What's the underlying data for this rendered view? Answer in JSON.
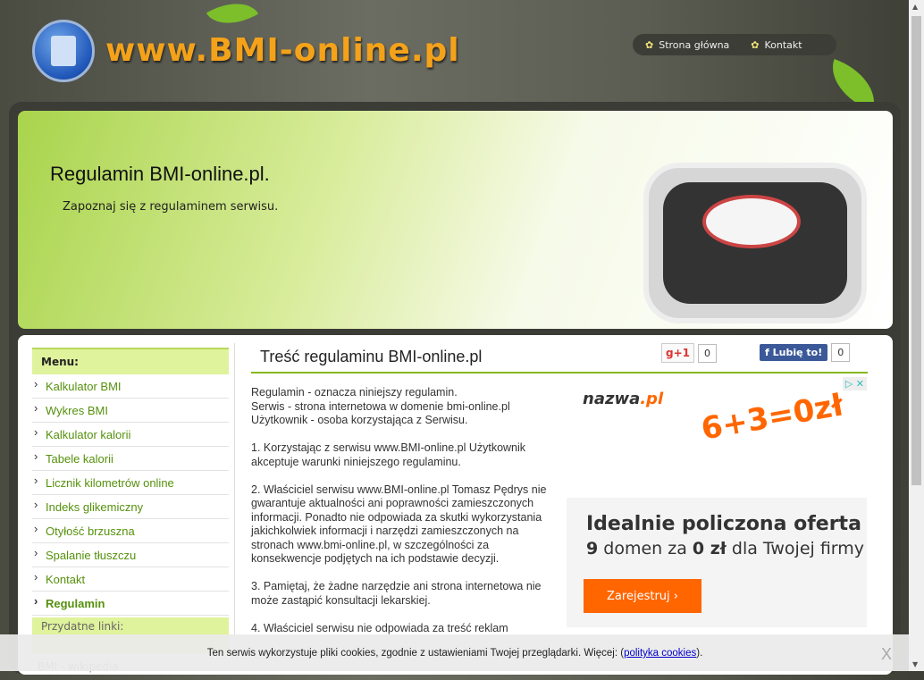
{
  "header": {
    "site_name": "www.BMI-online.pl",
    "nav": [
      "Strona główna",
      "Kontakt"
    ]
  },
  "banner": {
    "title": "Regulamin BMI-online.pl.",
    "subtitle": "Zapoznaj się z regulaminem serwisu."
  },
  "sidebar": {
    "menu_title": "Menu:",
    "items": [
      "Kalkulator BMI",
      "Wykres BMI",
      "Kalkulator kalorii",
      "Tabele kalorii",
      "Licznik kilometrów online",
      "Indeks glikemiczny",
      "Otyłość brzuszna",
      "Spalanie tłuszczu",
      "Kontakt",
      "Regulamin"
    ],
    "links_title": "Przydatne linki:",
    "links": [
      "BMI - wikipedia"
    ]
  },
  "content": {
    "title": "Treść regulaminu BMI-online.pl",
    "gplus_label": "g+1",
    "gplus_count": "0",
    "fb_label": "Lubię to!",
    "fb_count": "0",
    "paragraphs": [
      "Regulamin - oznacza niniejszy regulamin.\nSerwis - strona internetowa w domenie bmi-online.pl\nUżytkownik - osoba korzystająca z Serwisu.",
      "1. Korzystając z serwisu www.BMI-online.pl Użytkownik akceptuje warunki niniejszego regulaminu.",
      "2. Właściciel serwisu www.BMI-online.pl Tomasz Pędrys nie gwarantuje aktualności ani poprawności zamieszczonych informacji. Ponadto nie odpowiada za skutki wykorzystania jakichkolwiek informacji i narzędzi zamieszczonych na stronach www.bmi-online.pl, w szczególności za konsekwencje podjętych na ich podstawie decyzji.",
      "3. Pamiętaj, że żadne narzędzie ani strona internetowa nie może zastąpić konsultacji lekarskiej.",
      "4. Właściciel serwisu nie odpowiada za treść reklam"
    ]
  },
  "ad": {
    "brand": "nazwa",
    "brand_tld": ".pl",
    "art": "6+3=0zł",
    "headline": "Idealnie policzona oferta",
    "sub_bold1": "9",
    "sub_mid": " domen za ",
    "sub_bold2": "0 zł",
    "sub_end": " dla Twojej firmy",
    "cta": "Zarejestruj  ›"
  },
  "cookie": {
    "text": "Ten serwis wykorzystuje pliki cookies, zgodnie z ustawieniami Twojej przeglądarki. Więcej: (",
    "link": "polityka cookies",
    "end": ").",
    "close": "X"
  }
}
